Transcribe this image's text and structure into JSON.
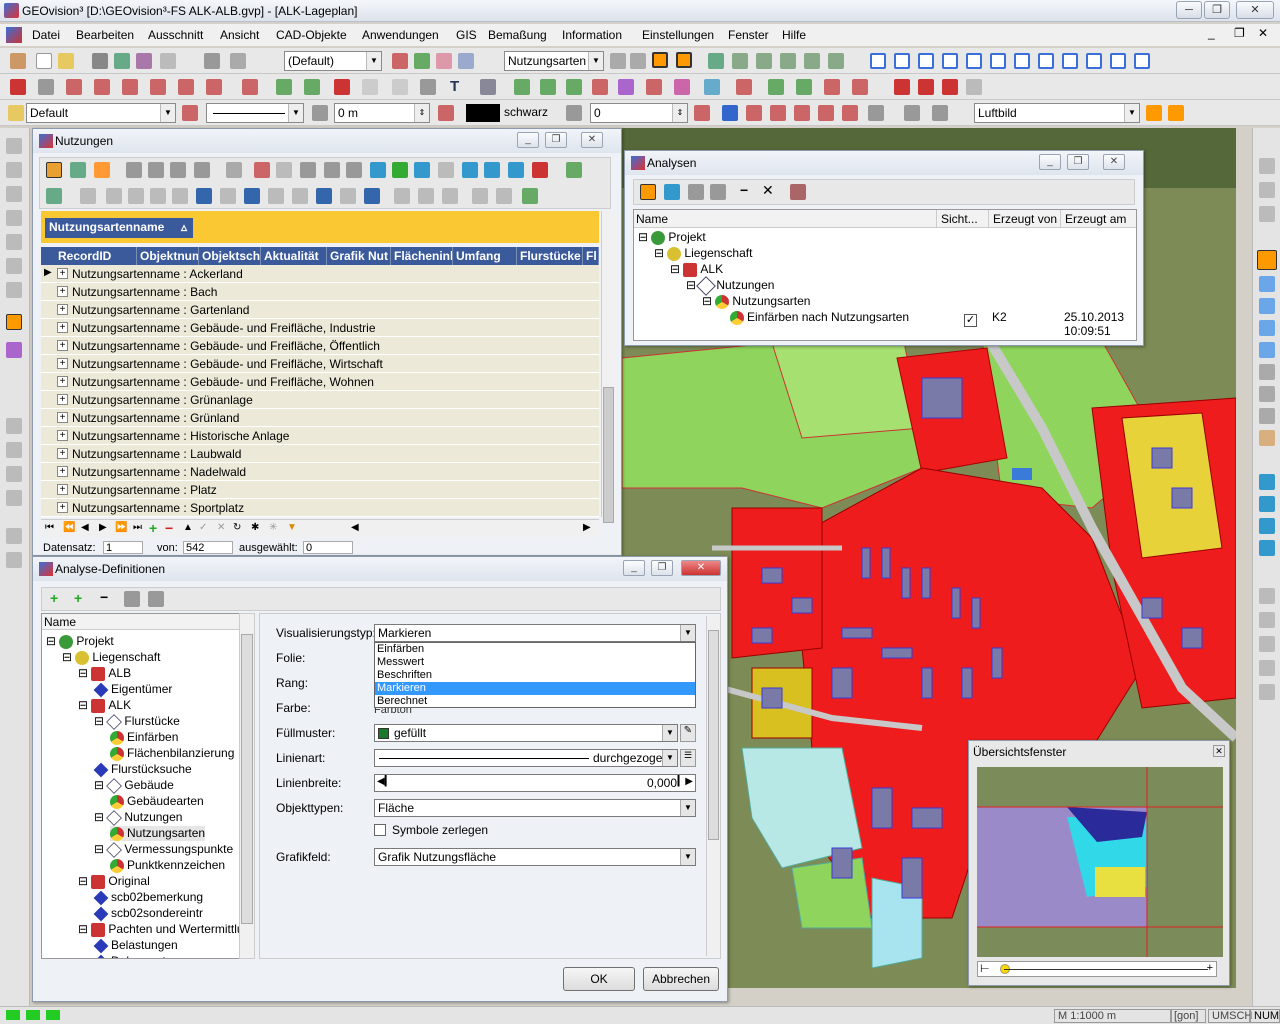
{
  "app": {
    "title": "GEOvision³  [D:\\GEOvision³-FS ALK-ALB.gvp] - [ALK-Lageplan]",
    "window_controls": [
      "─",
      "❐",
      "✕"
    ],
    "inner_controls": [
      "_",
      "❐",
      "✕"
    ]
  },
  "menu": [
    "Datei",
    "Bearbeiten",
    "Ausschnitt",
    "Ansicht",
    "CAD-Objekte",
    "Anwendungen",
    "GIS",
    "Bemaßung",
    "Information",
    "Einstellungen",
    "Fenster",
    "Hilfe"
  ],
  "toolbar": {
    "scale_combo": "(Default)",
    "layer_combo": "Nutzungsarten",
    "style_combo": "Default",
    "distance": "0 m",
    "color_name": "schwarz",
    "value": "0",
    "background_combo": "Luftbild"
  },
  "nutzungen": {
    "title": "Nutzungen",
    "group_header": "Nutzungsartenname",
    "columns": [
      "RecordID",
      "Objektnum",
      "Objektsch",
      "Aktualität",
      "Grafik Nut",
      "Flächeninl",
      "Umfang",
      "Flurstücke",
      "Fl"
    ],
    "rows": [
      "Nutzungsartenname : Ackerland",
      "Nutzungsartenname : Bach",
      "Nutzungsartenname : Gartenland",
      "Nutzungsartenname : Gebäude- und Freifläche, Industrie",
      "Nutzungsartenname : Gebäude- und Freifläche, Öffentlich",
      "Nutzungsartenname : Gebäude- und Freifläche, Wirtschaft",
      "Nutzungsartenname : Gebäude- und Freifläche, Wohnen",
      "Nutzungsartenname : Grünanlage",
      "Nutzungsartenname : Grünland",
      "Nutzungsartenname : Historische Anlage",
      "Nutzungsartenname : Laubwald",
      "Nutzungsartenname : Nadelwald",
      "Nutzungsartenname : Platz",
      "Nutzungsartenname : Sportplatz"
    ],
    "status": {
      "label_record": "Datensatz:",
      "record": "1",
      "label_of": "von:",
      "total": "542",
      "label_selected": "ausgewählt:",
      "selected": "0"
    }
  },
  "analysen": {
    "title": "Analysen",
    "columns": [
      "Name",
      "Sicht...",
      "Erzeugt von",
      "Erzeugt am"
    ],
    "tree": [
      "Projekt",
      "Liegenschaft",
      "ALK",
      "Nutzungen",
      "Nutzungsarten",
      "Einfärben nach Nutzungsarten"
    ],
    "creator": "K2",
    "date": "25.10.2013",
    "time": "10:09:51"
  },
  "analyse_def": {
    "title": "Analyse-Definitionen",
    "tree_header": "Name",
    "tree": [
      {
        "label": "Projekt",
        "level": 0,
        "icon": "globe"
      },
      {
        "label": "Liegenschaft",
        "level": 1,
        "icon": "globe2"
      },
      {
        "label": "ALB",
        "level": 2,
        "icon": "car"
      },
      {
        "label": "Eigentümer",
        "level": 3,
        "icon": "diamond"
      },
      {
        "label": "ALK",
        "level": 2,
        "icon": "car"
      },
      {
        "label": "Flurstücke",
        "level": 3,
        "icon": "poly"
      },
      {
        "label": "Einfärben",
        "level": 4,
        "icon": "pie"
      },
      {
        "label": "Flächenbilanzierung",
        "level": 4,
        "icon": "pie"
      },
      {
        "label": "Flurstücksuche",
        "level": 3,
        "icon": "diamond"
      },
      {
        "label": "Gebäude",
        "level": 3,
        "icon": "poly"
      },
      {
        "label": "Gebäudearten",
        "level": 4,
        "icon": "pie"
      },
      {
        "label": "Nutzungen",
        "level": 3,
        "icon": "poly"
      },
      {
        "label": "Nutzungsarten",
        "level": 4,
        "icon": "pie"
      },
      {
        "label": "Vermessungspunkte",
        "level": 3,
        "icon": "poly"
      },
      {
        "label": "Punktkennzeichen",
        "level": 4,
        "icon": "pie"
      },
      {
        "label": "Original",
        "level": 2,
        "icon": "car"
      },
      {
        "label": "scb02bemerkung",
        "level": 3,
        "icon": "diamond"
      },
      {
        "label": "scb02sondereintr",
        "level": 3,
        "icon": "diamond"
      },
      {
        "label": "Pachten und Wertermittlu...",
        "level": 2,
        "icon": "car"
      },
      {
        "label": "Belastungen",
        "level": 3,
        "icon": "diamond"
      },
      {
        "label": "Dokumente",
        "level": 3,
        "icon": "diamond"
      }
    ],
    "labels": {
      "vistyp": "Visualisierungstyp:",
      "folie": "Folie:",
      "rang": "Rang:",
      "farbe": "Farbe:",
      "fuell": "Füllmuster:",
      "linienart": "Linienart:",
      "linienbreite": "Linienbreite:",
      "objekttypen": "Objekttypen:",
      "grafikfeld": "Grafikfeld:"
    },
    "values": {
      "vistyp": "Markieren",
      "fuell": "gefüllt",
      "linienart": "durchgezogen",
      "linienbreite": "0,000",
      "objekttypen": "Fläche",
      "grafikfeld": "Grafik Nutzungsfläche",
      "symbole": "Symbole zerlegen",
      "hidden_behind": "Farbton"
    },
    "dropdown": [
      "Einfärben",
      "Messwert",
      "Beschriften",
      "Markieren",
      "Berechnet"
    ],
    "dropdown_selected": 3,
    "ok": "OK",
    "cancel": "Abbrechen"
  },
  "overview": {
    "title": "Übersichtsfenster"
  },
  "statusbar": {
    "scale": "M 1:1000  m",
    "units": "[gon]",
    "caps": "UMSCH",
    "num": "NUM"
  },
  "colors": {
    "accent": "#3399ff",
    "header_yellow": "#f9c832",
    "grid_header": "#3a5a9c",
    "map_red": "#ee1c1c",
    "map_green": "#8fd45c"
  }
}
